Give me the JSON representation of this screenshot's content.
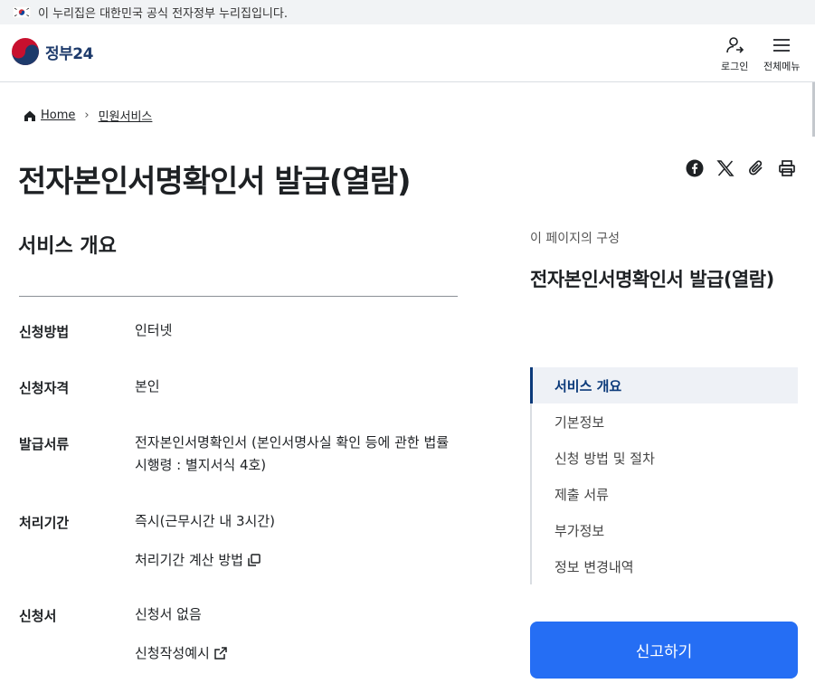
{
  "notice": {
    "text": "이 누리집은 대한민국 공식 전자정부 누리집입니다."
  },
  "header": {
    "logo_text": "정부",
    "logo_num": "24",
    "login_label": "로그인",
    "menu_label": "전체메뉴"
  },
  "breadcrumb": {
    "home": "Home",
    "current": "민원서비스"
  },
  "page": {
    "title": "전자본인서명확인서 발급(열람)"
  },
  "share": {
    "icons": [
      "facebook-icon",
      "x-twitter-icon",
      "link-clip-icon",
      "print-icon"
    ]
  },
  "overview": {
    "title": "서비스 개요",
    "rows": [
      {
        "label": "신청방법",
        "value": "인터넷"
      },
      {
        "label": "신청자격",
        "value": "본인"
      },
      {
        "label": "발급서류",
        "value": "전자본인서명확인서 (본인서명사실 확인 등에 관한 법률 시행령 : 별지서식 4호)"
      },
      {
        "label": "처리기간",
        "value": "즉시(근무시간 내 3시간)",
        "link": "처리기간 계산 방법"
      },
      {
        "label": "신청서",
        "value": "신청서 없음",
        "link": "신청작성예시"
      }
    ]
  },
  "toc": {
    "caption": "이 페이지의 구성",
    "title": "전자본인서명확인서 발급(열람)",
    "items": [
      "서비스 개요",
      "기본정보",
      "신청 방법 및 절차",
      "제출 서류",
      "부가정보",
      "정보 변경내역"
    ]
  },
  "report_button": {
    "label": "신고하기"
  },
  "colors": {
    "primary": "#256ef4",
    "navy": "#0b3a7a",
    "text": "#1e2124"
  }
}
